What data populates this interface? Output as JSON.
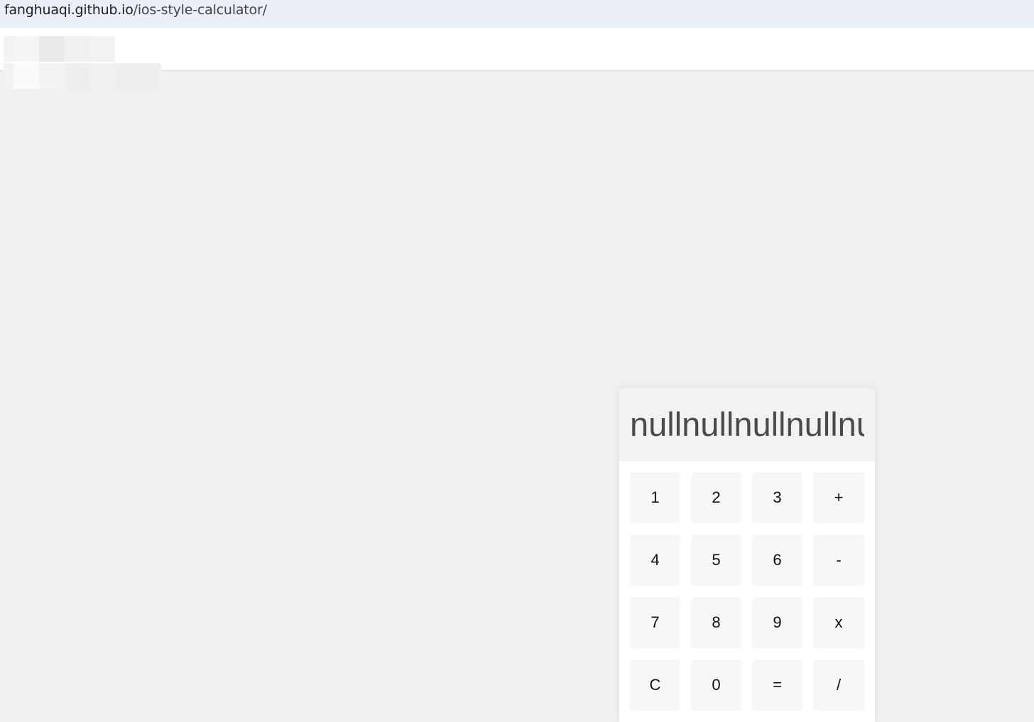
{
  "browser": {
    "url_host": "fanghuaqi.github.io",
    "url_path": "/ios-style-calculator/"
  },
  "calculator": {
    "display": "nullnullnullnullnull",
    "keys": [
      [
        "1",
        "2",
        "3",
        "+"
      ],
      [
        "4",
        "5",
        "6",
        "-"
      ],
      [
        "7",
        "8",
        "9",
        "x"
      ],
      [
        "C",
        "0",
        "=",
        "/"
      ]
    ]
  },
  "colors": {
    "page_background": "#f0f0f0",
    "address_bar": "#eaeff8",
    "display_background": "#f2f2f2",
    "key_background": "#f7f7f7",
    "display_text": "#4a4a4a"
  }
}
